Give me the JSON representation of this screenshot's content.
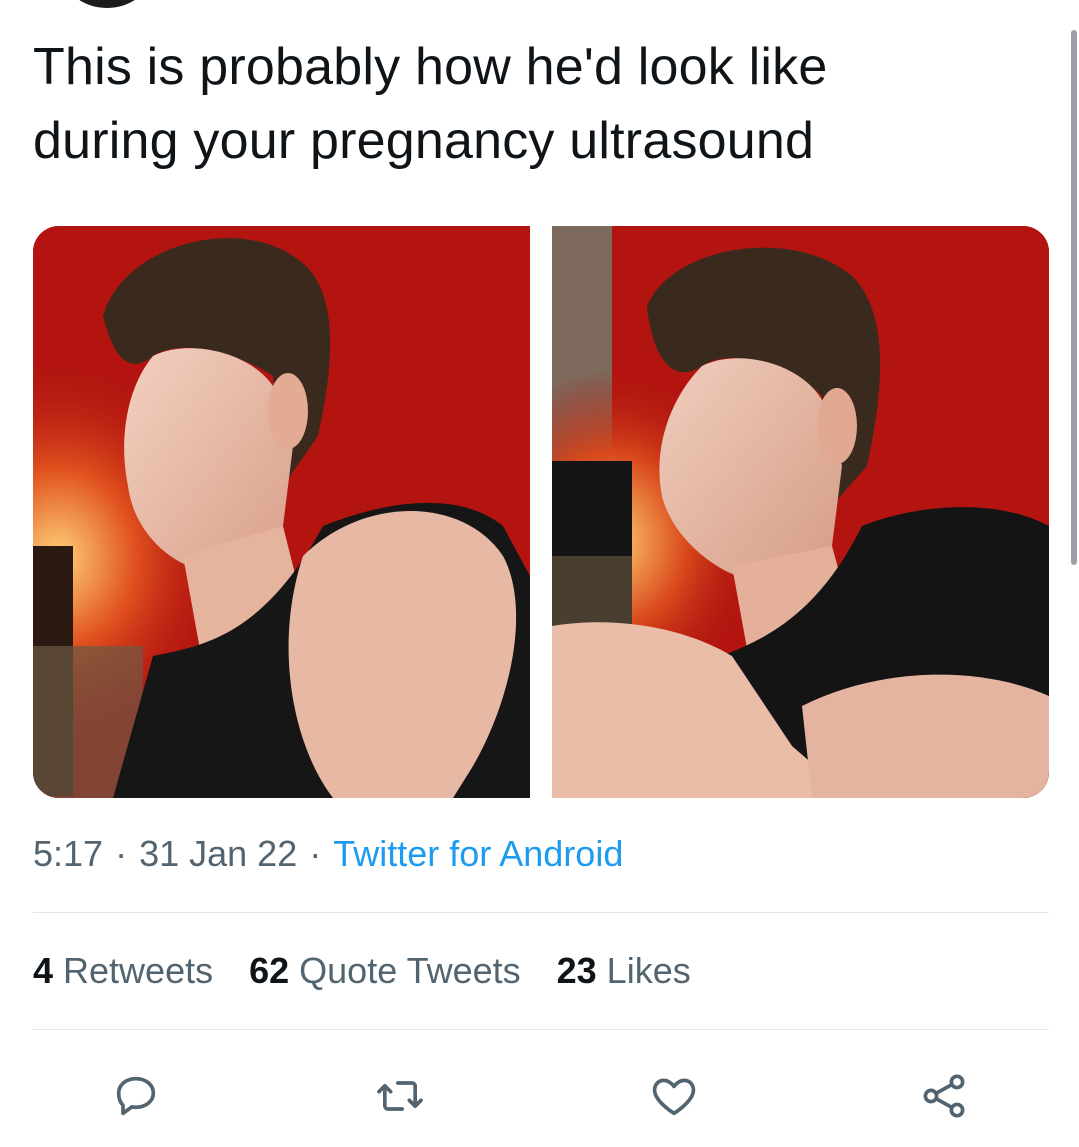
{
  "tweet": {
    "text_lines": [
      "This is probably how he'd look like",
      "during your pregnancy ultrasound"
    ]
  },
  "media": {
    "photos": [
      {
        "name": "photo-left"
      },
      {
        "name": "photo-right"
      }
    ]
  },
  "meta": {
    "time": "5:17",
    "separator": "·",
    "date": "31 Jan 22",
    "source": "Twitter for Android"
  },
  "stats": {
    "retweets_count": "4",
    "retweets_label": "Retweets",
    "quotes_count": "62",
    "quotes_label": "Quote Tweets",
    "likes_count": "23",
    "likes_label": "Likes"
  },
  "actions": {
    "reply_icon": "reply-icon",
    "retweet_icon": "retweet-icon",
    "like_icon": "heart-icon",
    "share_icon": "share-icon"
  },
  "colors": {
    "text": "#0f1419",
    "secondary": "#536471",
    "link": "#1d9bf0",
    "divider": "#e1e6ea"
  }
}
